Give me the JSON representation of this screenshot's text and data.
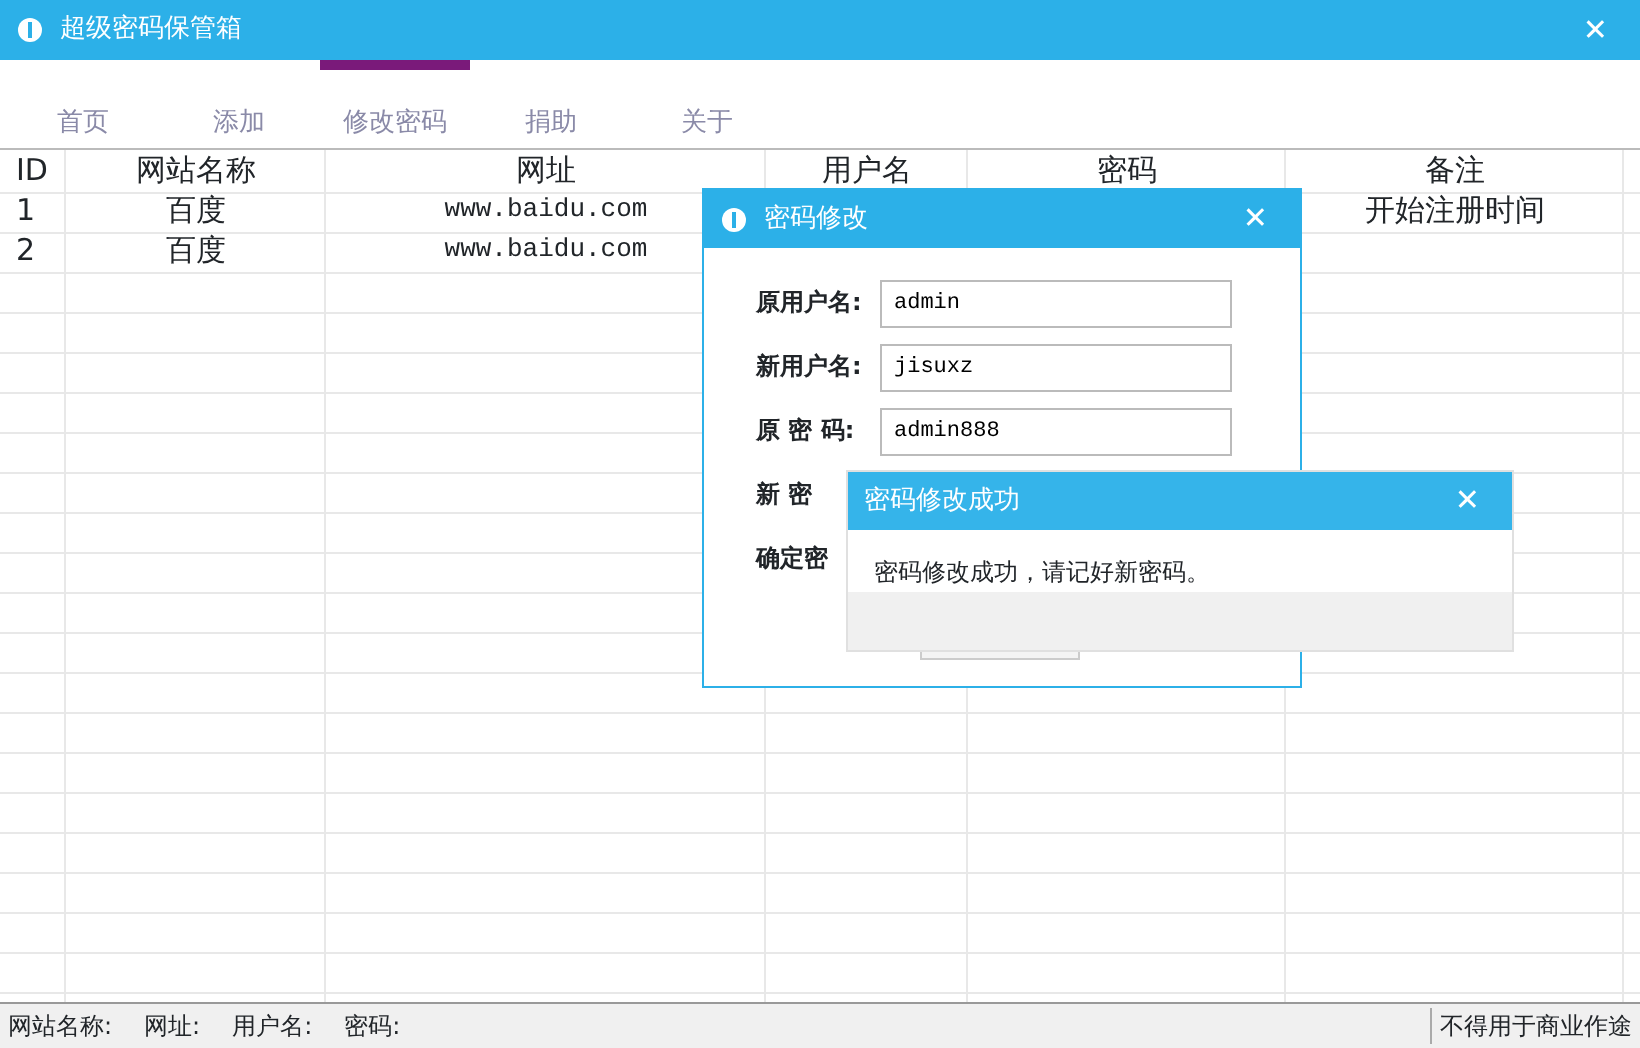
{
  "window": {
    "title": "超级密码保管箱",
    "close": "✕"
  },
  "tabs": [
    {
      "label": "首页",
      "selected": false
    },
    {
      "label": "添加",
      "selected": false
    },
    {
      "label": "修改密码",
      "selected": true
    },
    {
      "label": "捐助",
      "selected": false
    },
    {
      "label": "关于",
      "selected": false
    }
  ],
  "table": {
    "columns": [
      "ID",
      "网站名称",
      "网址",
      "用户名",
      "密码",
      "备注"
    ],
    "rows": [
      [
        "1",
        "百度",
        "www.baidu.com",
        "",
        "",
        "开始注册时间"
      ],
      [
        "2",
        "百度",
        "www.baidu.com",
        "",
        "",
        ""
      ]
    ]
  },
  "edit_dialog": {
    "title": "密码修改",
    "close": "✕",
    "fields": [
      {
        "label": "原用户名:",
        "value": "admin"
      },
      {
        "label": "新用户名:",
        "value": "jisuxz"
      },
      {
        "label": "原 密 码:",
        "value": "admin888"
      },
      {
        "label": "新 密"
      },
      {
        "label": "确定密"
      }
    ]
  },
  "success_dialog": {
    "title": "密码修改成功",
    "close": "✕",
    "message": "密码修改成功，请记好新密码。"
  },
  "status_bar": {
    "items": [
      "网站名称:",
      "网址:",
      "用户名:",
      "密码:"
    ],
    "note": "不得用于商业作途"
  }
}
